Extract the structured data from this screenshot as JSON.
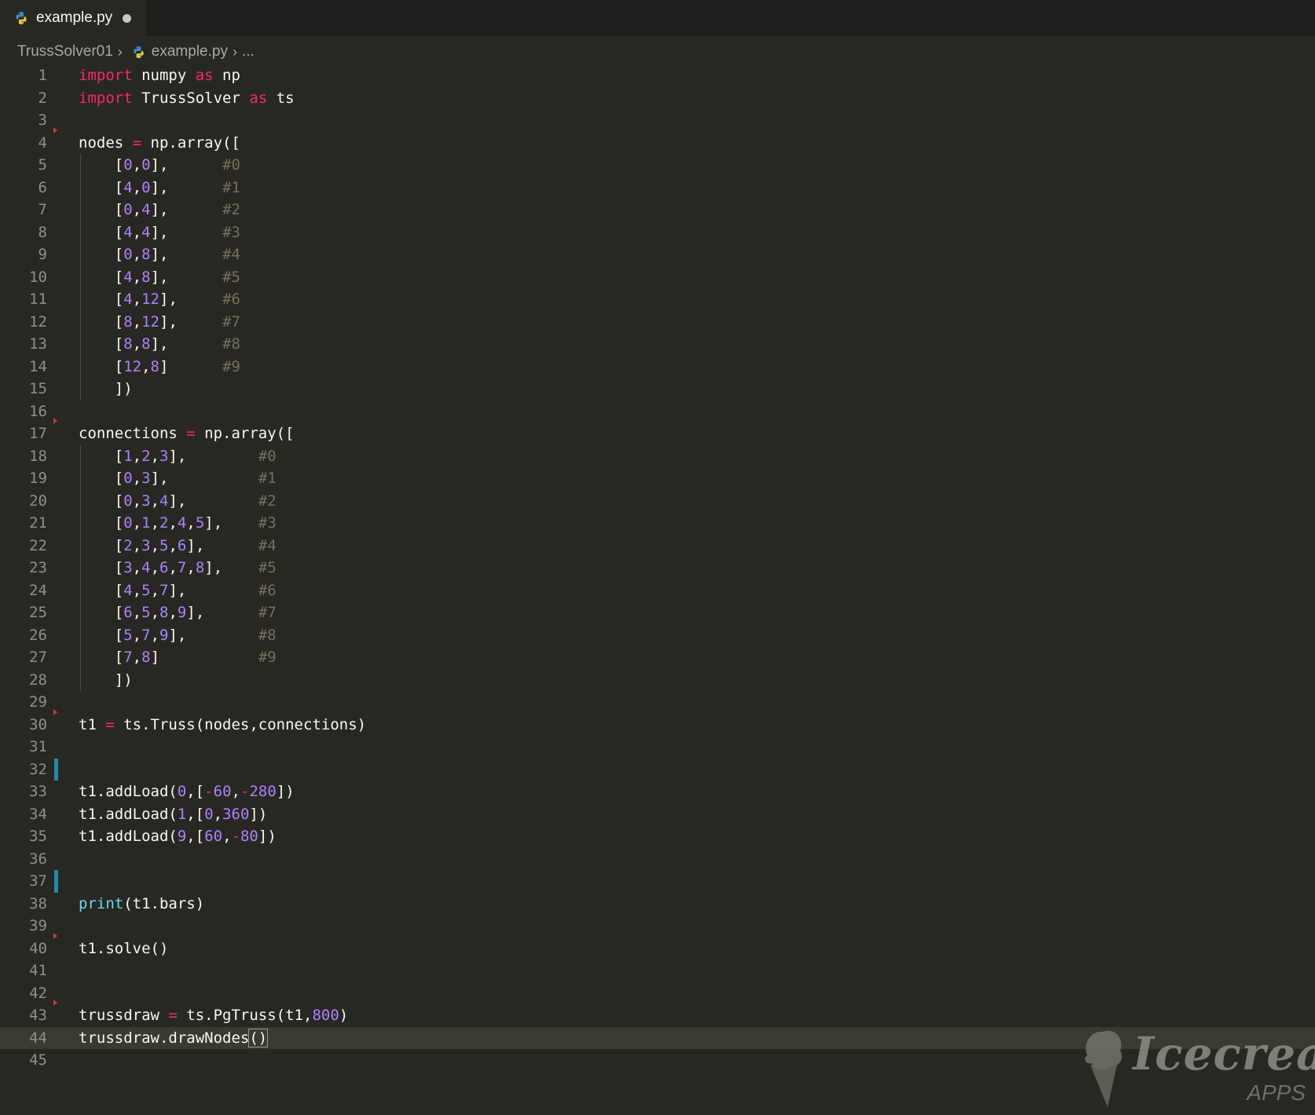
{
  "tab": {
    "label": "example.py",
    "icon": "python-file-icon"
  },
  "breadcrumb": {
    "folder": "TrussSolver01",
    "file": "example.py",
    "tail": "..."
  },
  "editor": {
    "current_line": 44,
    "lines": [
      {
        "n": "1",
        "tokens": [
          [
            "kw",
            "import"
          ],
          [
            "text",
            " numpy "
          ],
          [
            "kw",
            "as"
          ],
          [
            "text",
            " np"
          ]
        ]
      },
      {
        "n": "2",
        "tokens": [
          [
            "kw",
            "import"
          ],
          [
            "text",
            " TrussSolver "
          ],
          [
            "kw",
            "as"
          ],
          [
            "text",
            " ts"
          ]
        ]
      },
      {
        "n": "3",
        "tokens": []
      },
      {
        "n": "4",
        "fold": true,
        "tokens": [
          [
            "text",
            "nodes "
          ],
          [
            "op",
            "="
          ],
          [
            "text",
            " np.array(["
          ]
        ]
      },
      {
        "n": "5",
        "indent": true,
        "tokens": [
          [
            "text",
            "    ["
          ],
          [
            "num",
            "0"
          ],
          [
            "text",
            ","
          ],
          [
            "num",
            "0"
          ],
          [
            "text",
            "],      "
          ],
          [
            "cm",
            "#0"
          ]
        ]
      },
      {
        "n": "6",
        "indent": true,
        "tokens": [
          [
            "text",
            "    ["
          ],
          [
            "num",
            "4"
          ],
          [
            "text",
            ","
          ],
          [
            "num",
            "0"
          ],
          [
            "text",
            "],      "
          ],
          [
            "cm",
            "#1"
          ]
        ]
      },
      {
        "n": "7",
        "indent": true,
        "tokens": [
          [
            "text",
            "    ["
          ],
          [
            "num",
            "0"
          ],
          [
            "text",
            ","
          ],
          [
            "num",
            "4"
          ],
          [
            "text",
            "],      "
          ],
          [
            "cm",
            "#2"
          ]
        ]
      },
      {
        "n": "8",
        "indent": true,
        "tokens": [
          [
            "text",
            "    ["
          ],
          [
            "num",
            "4"
          ],
          [
            "text",
            ","
          ],
          [
            "num",
            "4"
          ],
          [
            "text",
            "],      "
          ],
          [
            "cm",
            "#3"
          ]
        ]
      },
      {
        "n": "9",
        "indent": true,
        "tokens": [
          [
            "text",
            "    ["
          ],
          [
            "num",
            "0"
          ],
          [
            "text",
            ","
          ],
          [
            "num",
            "8"
          ],
          [
            "text",
            "],      "
          ],
          [
            "cm",
            "#4"
          ]
        ]
      },
      {
        "n": "10",
        "indent": true,
        "tokens": [
          [
            "text",
            "    ["
          ],
          [
            "num",
            "4"
          ],
          [
            "text",
            ","
          ],
          [
            "num",
            "8"
          ],
          [
            "text",
            "],      "
          ],
          [
            "cm",
            "#5"
          ]
        ]
      },
      {
        "n": "11",
        "indent": true,
        "tokens": [
          [
            "text",
            "    ["
          ],
          [
            "num",
            "4"
          ],
          [
            "text",
            ","
          ],
          [
            "num",
            "12"
          ],
          [
            "text",
            "],     "
          ],
          [
            "cm",
            "#6"
          ]
        ]
      },
      {
        "n": "12",
        "indent": true,
        "tokens": [
          [
            "text",
            "    ["
          ],
          [
            "num",
            "8"
          ],
          [
            "text",
            ","
          ],
          [
            "num",
            "12"
          ],
          [
            "text",
            "],     "
          ],
          [
            "cm",
            "#7"
          ]
        ]
      },
      {
        "n": "13",
        "indent": true,
        "tokens": [
          [
            "text",
            "    ["
          ],
          [
            "num",
            "8"
          ],
          [
            "text",
            ","
          ],
          [
            "num",
            "8"
          ],
          [
            "text",
            "],      "
          ],
          [
            "cm",
            "#8"
          ]
        ]
      },
      {
        "n": "14",
        "indent": true,
        "tokens": [
          [
            "text",
            "    ["
          ],
          [
            "num",
            "12"
          ],
          [
            "text",
            ","
          ],
          [
            "num",
            "8"
          ],
          [
            "text",
            "]      "
          ],
          [
            "cm",
            "#9"
          ]
        ]
      },
      {
        "n": "15",
        "indent": true,
        "tokens": [
          [
            "text",
            "    ])"
          ]
        ]
      },
      {
        "n": "16",
        "tokens": []
      },
      {
        "n": "17",
        "fold": true,
        "tokens": [
          [
            "text",
            "connections "
          ],
          [
            "op",
            "="
          ],
          [
            "text",
            " np.array(["
          ]
        ]
      },
      {
        "n": "18",
        "indent": true,
        "tokens": [
          [
            "text",
            "    ["
          ],
          [
            "num",
            "1"
          ],
          [
            "text",
            ","
          ],
          [
            "num",
            "2"
          ],
          [
            "text",
            ","
          ],
          [
            "num",
            "3"
          ],
          [
            "text",
            "],        "
          ],
          [
            "cm",
            "#0"
          ]
        ]
      },
      {
        "n": "19",
        "indent": true,
        "tokens": [
          [
            "text",
            "    ["
          ],
          [
            "num",
            "0"
          ],
          [
            "text",
            ","
          ],
          [
            "num",
            "3"
          ],
          [
            "text",
            "],          "
          ],
          [
            "cm",
            "#1"
          ]
        ]
      },
      {
        "n": "20",
        "indent": true,
        "tokens": [
          [
            "text",
            "    ["
          ],
          [
            "num",
            "0"
          ],
          [
            "text",
            ","
          ],
          [
            "num",
            "3"
          ],
          [
            "text",
            ","
          ],
          [
            "num",
            "4"
          ],
          [
            "text",
            "],        "
          ],
          [
            "cm",
            "#2"
          ]
        ]
      },
      {
        "n": "21",
        "indent": true,
        "tokens": [
          [
            "text",
            "    ["
          ],
          [
            "num",
            "0"
          ],
          [
            "text",
            ","
          ],
          [
            "num",
            "1"
          ],
          [
            "text",
            ","
          ],
          [
            "num",
            "2"
          ],
          [
            "text",
            ","
          ],
          [
            "num",
            "4"
          ],
          [
            "text",
            ","
          ],
          [
            "num",
            "5"
          ],
          [
            "text",
            "],    "
          ],
          [
            "cm",
            "#3"
          ]
        ]
      },
      {
        "n": "22",
        "indent": true,
        "tokens": [
          [
            "text",
            "    ["
          ],
          [
            "num",
            "2"
          ],
          [
            "text",
            ","
          ],
          [
            "num",
            "3"
          ],
          [
            "text",
            ","
          ],
          [
            "num",
            "5"
          ],
          [
            "text",
            ","
          ],
          [
            "num",
            "6"
          ],
          [
            "text",
            "],      "
          ],
          [
            "cm",
            "#4"
          ]
        ]
      },
      {
        "n": "23",
        "indent": true,
        "tokens": [
          [
            "text",
            "    ["
          ],
          [
            "num",
            "3"
          ],
          [
            "text",
            ","
          ],
          [
            "num",
            "4"
          ],
          [
            "text",
            ","
          ],
          [
            "num",
            "6"
          ],
          [
            "text",
            ","
          ],
          [
            "num",
            "7"
          ],
          [
            "text",
            ","
          ],
          [
            "num",
            "8"
          ],
          [
            "text",
            "],    "
          ],
          [
            "cm",
            "#5"
          ]
        ]
      },
      {
        "n": "24",
        "indent": true,
        "tokens": [
          [
            "text",
            "    ["
          ],
          [
            "num",
            "4"
          ],
          [
            "text",
            ","
          ],
          [
            "num",
            "5"
          ],
          [
            "text",
            ","
          ],
          [
            "num",
            "7"
          ],
          [
            "text",
            "],        "
          ],
          [
            "cm",
            "#6"
          ]
        ]
      },
      {
        "n": "25",
        "indent": true,
        "tokens": [
          [
            "text",
            "    ["
          ],
          [
            "num",
            "6"
          ],
          [
            "text",
            ","
          ],
          [
            "num",
            "5"
          ],
          [
            "text",
            ","
          ],
          [
            "num",
            "8"
          ],
          [
            "text",
            ","
          ],
          [
            "num",
            "9"
          ],
          [
            "text",
            "],      "
          ],
          [
            "cm",
            "#7"
          ]
        ]
      },
      {
        "n": "26",
        "indent": true,
        "tokens": [
          [
            "text",
            "    ["
          ],
          [
            "num",
            "5"
          ],
          [
            "text",
            ","
          ],
          [
            "num",
            "7"
          ],
          [
            "text",
            ","
          ],
          [
            "num",
            "9"
          ],
          [
            "text",
            "],        "
          ],
          [
            "cm",
            "#8"
          ]
        ]
      },
      {
        "n": "27",
        "indent": true,
        "tokens": [
          [
            "text",
            "    ["
          ],
          [
            "num",
            "7"
          ],
          [
            "text",
            ","
          ],
          [
            "num",
            "8"
          ],
          [
            "text",
            "]           "
          ],
          [
            "cm",
            "#9"
          ]
        ]
      },
      {
        "n": "28",
        "indent": true,
        "tokens": [
          [
            "text",
            "    ])"
          ]
        ]
      },
      {
        "n": "29",
        "tokens": []
      },
      {
        "n": "30",
        "fold": true,
        "tokens": [
          [
            "text",
            "t1 "
          ],
          [
            "op",
            "="
          ],
          [
            "text",
            " ts.Truss(nodes,connections)"
          ]
        ]
      },
      {
        "n": "31",
        "tokens": []
      },
      {
        "n": "32",
        "mark": true,
        "tokens": []
      },
      {
        "n": "33",
        "tokens": [
          [
            "text",
            "t1.addLoad("
          ],
          [
            "num",
            "0"
          ],
          [
            "text",
            ",["
          ],
          [
            "op",
            "-"
          ],
          [
            "num",
            "60"
          ],
          [
            "text",
            ","
          ],
          [
            "op",
            "-"
          ],
          [
            "num",
            "280"
          ],
          [
            "text",
            "])"
          ]
        ]
      },
      {
        "n": "34",
        "tokens": [
          [
            "text",
            "t1.addLoad("
          ],
          [
            "num",
            "1"
          ],
          [
            "text",
            ",["
          ],
          [
            "num",
            "0"
          ],
          [
            "text",
            ","
          ],
          [
            "num",
            "360"
          ],
          [
            "text",
            "])"
          ]
        ]
      },
      {
        "n": "35",
        "tokens": [
          [
            "text",
            "t1.addLoad("
          ],
          [
            "num",
            "9"
          ],
          [
            "text",
            ",["
          ],
          [
            "num",
            "60"
          ],
          [
            "text",
            ","
          ],
          [
            "op",
            "-"
          ],
          [
            "num",
            "80"
          ],
          [
            "text",
            "])"
          ]
        ]
      },
      {
        "n": "36",
        "tokens": []
      },
      {
        "n": "37",
        "mark": true,
        "tokens": []
      },
      {
        "n": "38",
        "tokens": [
          [
            "fn",
            "print"
          ],
          [
            "text",
            "(t1.bars)"
          ]
        ]
      },
      {
        "n": "39",
        "tokens": []
      },
      {
        "n": "40",
        "fold": true,
        "tokens": [
          [
            "text",
            "t1.solve()"
          ]
        ]
      },
      {
        "n": "41",
        "tokens": []
      },
      {
        "n": "42",
        "tokens": []
      },
      {
        "n": "43",
        "fold": true,
        "tokens": [
          [
            "text",
            "trussdraw "
          ],
          [
            "op",
            "="
          ],
          [
            "text",
            " ts.PgTruss(t1,"
          ],
          [
            "num",
            "800"
          ],
          [
            "text",
            ")"
          ]
        ]
      },
      {
        "n": "44",
        "tokens": [
          [
            "text",
            "trussdraw.drawNodes"
          ],
          [
            "cursor",
            "()"
          ]
        ]
      },
      {
        "n": "45",
        "tokens": []
      }
    ]
  },
  "watermark": {
    "brand": "Icecream",
    "sub": "APPS"
  },
  "colors": {
    "background": "#272822",
    "keyword": "#f92672",
    "number": "#ae81ff",
    "comment": "#75715e",
    "builtin": "#66d9ef",
    "text": "#f8f8f2"
  }
}
